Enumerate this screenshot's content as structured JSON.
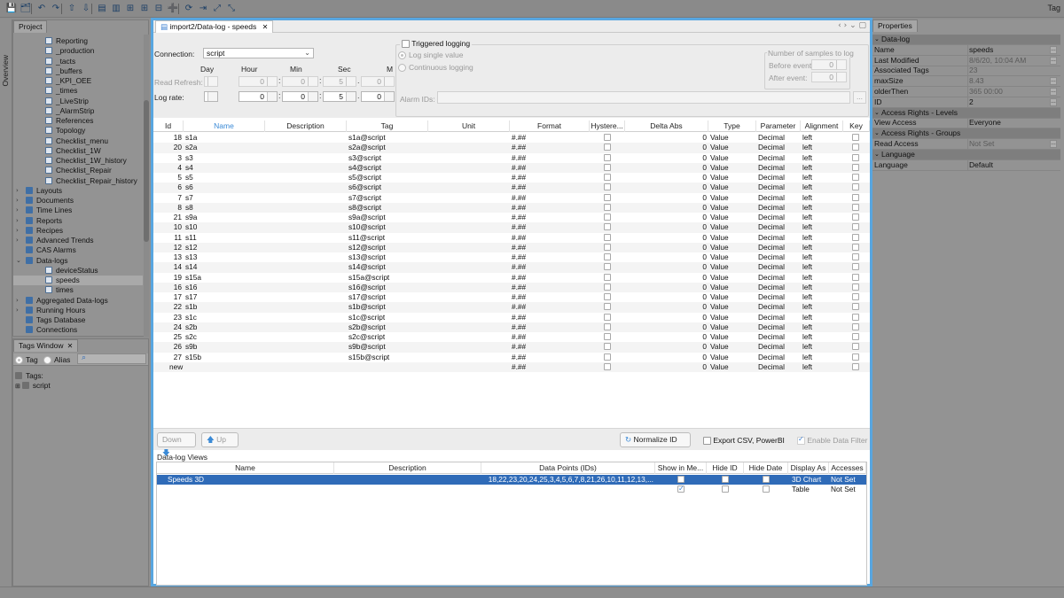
{
  "toolbar": {
    "tags_label": "Tag",
    "icons": [
      "save-icon",
      "save-all-icon",
      "undo-icon",
      "redo-icon",
      "export-icon",
      "import-icon",
      "layout-icon",
      "layout-icon",
      "new-icon",
      "new-icon",
      "align-icon",
      "add-icon",
      "refresh-icon",
      "login-icon",
      "expand-icon",
      "collapse-icon"
    ]
  },
  "side_tab": {
    "label": "Overview"
  },
  "project": {
    "tab_label": "Project",
    "items": [
      {
        "label": "Reporting",
        "icon": "file-icon",
        "indent": 2
      },
      {
        "label": "_production",
        "icon": "file-icon",
        "indent": 2
      },
      {
        "label": "_tacts",
        "icon": "file-icon",
        "indent": 2
      },
      {
        "label": "_buffers",
        "icon": "file-icon",
        "indent": 2
      },
      {
        "label": "_KPI_OEE",
        "icon": "file-icon",
        "indent": 2
      },
      {
        "label": "_times",
        "icon": "file-icon",
        "indent": 2
      },
      {
        "label": "_LiveStrip",
        "icon": "file-icon",
        "indent": 2
      },
      {
        "label": "_AlarmStrip",
        "icon": "file-icon",
        "indent": 2
      },
      {
        "label": "References",
        "icon": "file-icon",
        "indent": 2
      },
      {
        "label": "Topology",
        "icon": "file-icon",
        "indent": 2
      },
      {
        "label": "Checklist_menu",
        "icon": "file-icon",
        "indent": 2
      },
      {
        "label": "Checklist_1W",
        "icon": "file-icon",
        "indent": 2
      },
      {
        "label": "Checklist_1W_history",
        "icon": "file-icon",
        "indent": 2
      },
      {
        "label": "Checklist_Repair",
        "icon": "file-icon",
        "indent": 2
      },
      {
        "label": "Checklist_Repair_history",
        "icon": "file-icon",
        "indent": 2
      },
      {
        "label": "Layouts",
        "icon": "layouts-icon",
        "indent": 1,
        "arrow": "›"
      },
      {
        "label": "Documents",
        "icon": "documents-icon",
        "indent": 1,
        "arrow": "›"
      },
      {
        "label": "Time Lines",
        "icon": "timelines-icon",
        "indent": 1,
        "arrow": "›"
      },
      {
        "label": "Reports",
        "icon": "reports-icon",
        "indent": 1,
        "arrow": "›"
      },
      {
        "label": "Recipes",
        "icon": "recipes-icon",
        "indent": 1,
        "arrow": "›"
      },
      {
        "label": "Advanced Trends",
        "icon": "trends-icon",
        "indent": 1,
        "arrow": "›"
      },
      {
        "label": "CAS Alarms",
        "icon": "alarms-icon",
        "indent": 1
      },
      {
        "label": "Data-logs",
        "icon": "datalogs-icon",
        "indent": 1,
        "arrow": "⌄"
      },
      {
        "label": "deviceStatus",
        "icon": "file-icon",
        "indent": 2
      },
      {
        "label": "speeds",
        "icon": "file-icon",
        "indent": 2,
        "selected": true
      },
      {
        "label": "times",
        "icon": "file-icon",
        "indent": 2
      },
      {
        "label": "Aggregated Data-logs",
        "icon": "aggregated-icon",
        "indent": 1,
        "arrow": "›"
      },
      {
        "label": "Running Hours",
        "icon": "clock-icon",
        "indent": 1,
        "arrow": "›"
      },
      {
        "label": "Tags Database",
        "icon": "database-icon",
        "indent": 1
      },
      {
        "label": "Connections",
        "icon": "connections-icon",
        "indent": 1
      }
    ]
  },
  "tags_window": {
    "tab_label": "Tags Window",
    "radio_tag": "Tag",
    "radio_alias": "Alias",
    "root_label": "Tags:",
    "child_label": "script"
  },
  "document": {
    "tab_label": "import2/Data-log - speeds",
    "connection_label": "Connection:",
    "connection_value": "script",
    "col_day": "Day",
    "col_hour": "Hour",
    "col_min": "Min",
    "col_sec": "Sec",
    "col_ms": "M",
    "read_refresh_label": "Read Refresh:",
    "read_refresh": [
      "0",
      "0",
      "0",
      "5",
      "0"
    ],
    "log_rate_label": "Log rate:",
    "log_rate": [
      "0",
      "0",
      "0",
      "5",
      "0"
    ],
    "triggered_logging": "Triggered logging",
    "log_single_value": "Log single value",
    "continuous_logging": "Continuous logging",
    "samples_title": "Number of samples to log",
    "before_event_label": "Before event:",
    "before_event": "0",
    "after_event_label": "After event:",
    "after_event": "0",
    "alarm_ids_label": "Alarm IDs:",
    "alarm_ids_btn": "..."
  },
  "grid": {
    "headers": [
      "Id",
      "Name",
      "Description",
      "Tag",
      "Unit",
      "Format",
      "Hystere...",
      "Delta Abs",
      "Type",
      "Parameter",
      "Alignment",
      "Key"
    ],
    "rows": [
      {
        "id": "18",
        "name": "s1a",
        "tag": "s1a@script"
      },
      {
        "id": "20",
        "name": "s2a",
        "tag": "s2a@script"
      },
      {
        "id": "3",
        "name": "s3",
        "tag": "s3@script"
      },
      {
        "id": "4",
        "name": "s4",
        "tag": "s4@script"
      },
      {
        "id": "5",
        "name": "s5",
        "tag": "s5@script"
      },
      {
        "id": "6",
        "name": "s6",
        "tag": "s6@script"
      },
      {
        "id": "7",
        "name": "s7",
        "tag": "s7@script"
      },
      {
        "id": "8",
        "name": "s8",
        "tag": "s8@script"
      },
      {
        "id": "21",
        "name": "s9a",
        "tag": "s9a@script"
      },
      {
        "id": "10",
        "name": "s10",
        "tag": "s10@script"
      },
      {
        "id": "11",
        "name": "s11",
        "tag": "s11@script"
      },
      {
        "id": "12",
        "name": "s12",
        "tag": "s12@script"
      },
      {
        "id": "13",
        "name": "s13",
        "tag": "s13@script"
      },
      {
        "id": "14",
        "name": "s14",
        "tag": "s14@script"
      },
      {
        "id": "19",
        "name": "s15a",
        "tag": "s15a@script"
      },
      {
        "id": "16",
        "name": "s16",
        "tag": "s16@script"
      },
      {
        "id": "17",
        "name": "s17",
        "tag": "s17@script"
      },
      {
        "id": "22",
        "name": "s1b",
        "tag": "s1b@script"
      },
      {
        "id": "23",
        "name": "s1c",
        "tag": "s1c@script"
      },
      {
        "id": "24",
        "name": "s2b",
        "tag": "s2b@script"
      },
      {
        "id": "25",
        "name": "s2c",
        "tag": "s2c@script"
      },
      {
        "id": "26",
        "name": "s9b",
        "tag": "s9b@script"
      },
      {
        "id": "27",
        "name": "s15b",
        "tag": "s15b@script"
      }
    ],
    "format": "#.##",
    "delta": "0",
    "type": "Value",
    "parameter": "Decimal",
    "alignment": "left",
    "new_row": {
      "id": "new",
      "format": "#.##",
      "delta": "0",
      "type": "Value",
      "parameter": "Decimal",
      "alignment": "left"
    }
  },
  "buttons": {
    "down": "Down",
    "up": "Up",
    "normalize": "Normalize ID",
    "export_csv": "Export CSV, PowerBI",
    "enable_filter": "Enable Data Filter"
  },
  "views": {
    "label": "Data-log Views",
    "headers": [
      "Name",
      "Description",
      "Data Points (IDs)",
      "Show in Me...",
      "Hide ID",
      "Hide Date",
      "Display As",
      "Accesses"
    ],
    "rows": [
      {
        "name": "Speeds 3D",
        "description": "",
        "points": "18,22,23,20,24,25,3,4,5,6,7,8,21,26,10,11,12,13,...",
        "show": true,
        "hide_id": false,
        "hide_date": false,
        "display": "3D Chart",
        "access": "Not Set",
        "selected": true
      },
      {
        "name": "",
        "description": "",
        "points": "",
        "show": true,
        "hide_id": false,
        "hide_date": false,
        "display": "Table",
        "access": "Not Set",
        "selected": false
      }
    ]
  },
  "properties": {
    "tab_label": "Properties",
    "rows": [
      {
        "section": "Data-log"
      },
      {
        "key": "Name",
        "value": "speeds",
        "btn": true
      },
      {
        "key": "Last Modified",
        "value": "8/6/20, 10:04 AM",
        "btn": true,
        "dim": true
      },
      {
        "key": "Associated Tags",
        "value": "23",
        "dim": true
      },
      {
        "key": "maxSize",
        "value": "8.43",
        "btn": true,
        "dim": true
      },
      {
        "key": "olderThen",
        "value": "365 00:00",
        "btn": true,
        "dim": true
      },
      {
        "key": "ID",
        "value": "2",
        "btn": true
      },
      {
        "section": "Access Rights - Levels"
      },
      {
        "key": "View Access",
        "value": "Everyone",
        "btn": false
      },
      {
        "section": "Access Rights - Groups"
      },
      {
        "key": "Read Access",
        "value": "Not Set",
        "btn": true,
        "dim": true
      },
      {
        "section": "Language"
      },
      {
        "key": "Language",
        "value": "Default",
        "btn": false
      }
    ]
  }
}
